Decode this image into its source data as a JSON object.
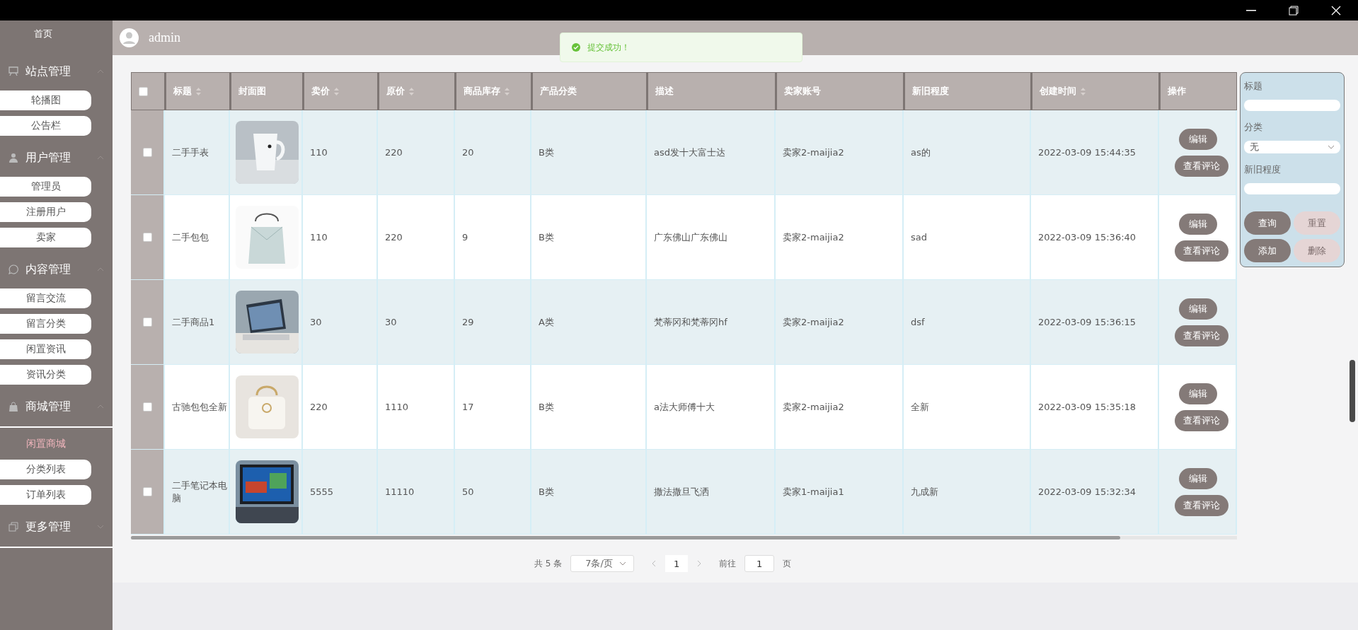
{
  "sidebar": {
    "home": "首页",
    "groups": [
      {
        "title": "站点管理",
        "expanded": true,
        "items": [
          {
            "label": "轮播图",
            "selected": false
          },
          {
            "label": "公告栏",
            "selected": false
          }
        ]
      },
      {
        "title": "用户管理",
        "expanded": true,
        "items": [
          {
            "label": "管理员",
            "selected": false
          },
          {
            "label": "注册用户",
            "selected": false
          },
          {
            "label": "卖家",
            "selected": false
          }
        ]
      },
      {
        "title": "内容管理",
        "expanded": true,
        "items": [
          {
            "label": "留言交流",
            "selected": false
          },
          {
            "label": "留言分类",
            "selected": false
          },
          {
            "label": "闲置资讯",
            "selected": false
          },
          {
            "label": "资讯分类",
            "selected": false
          }
        ]
      },
      {
        "title": "商城管理",
        "expanded": true,
        "items": [
          {
            "label": "闲置商城",
            "selected": true
          },
          {
            "label": "分类列表",
            "selected": false
          },
          {
            "label": "订单列表",
            "selected": false
          }
        ]
      },
      {
        "title": "更多管理",
        "expanded": false
      }
    ]
  },
  "header": {
    "username": "admin"
  },
  "toast": {
    "message": "提交成功！"
  },
  "table": {
    "all_checked": false,
    "columns": [
      {
        "label": "标题",
        "sortable": true
      },
      {
        "label": "封面图",
        "sortable": false
      },
      {
        "label": "卖价",
        "sortable": true
      },
      {
        "label": "原价",
        "sortable": true
      },
      {
        "label": "商品库存",
        "sortable": true
      },
      {
        "label": "产品分类",
        "sortable": false
      },
      {
        "label": "描述",
        "sortable": false
      },
      {
        "label": "卖家账号",
        "sortable": false
      },
      {
        "label": "新旧程度",
        "sortable": false
      },
      {
        "label": "创建时间",
        "sortable": true
      },
      {
        "label": "操作",
        "sortable": false
      }
    ],
    "rows": [
      {
        "checked": false,
        "title": "二手手表",
        "price": "110",
        "original_price": "220",
        "stock": "20",
        "category": "B类",
        "description": "asd发十大富士达",
        "seller": "卖家2-maijia2",
        "condition": "as的",
        "created": "2022-03-09 15:44:35",
        "actions": [
          "编辑",
          "查看评论"
        ]
      },
      {
        "checked": false,
        "title": "二手包包",
        "price": "110",
        "original_price": "220",
        "stock": "9",
        "category": "B类",
        "description": "广东佛山广东佛山",
        "seller": "卖家2-maijia2",
        "condition": "sad",
        "created": "2022-03-09 15:36:40",
        "actions": [
          "编辑",
          "查看评论"
        ]
      },
      {
        "checked": false,
        "title": "二手商品1",
        "price": "30",
        "original_price": "30",
        "stock": "29",
        "category": "A类",
        "description": "梵蒂冈和梵蒂冈hf",
        "seller": "卖家2-maijia2",
        "condition": "dsf",
        "created": "2022-03-09 15:36:15",
        "actions": [
          "编辑",
          "查看评论"
        ]
      },
      {
        "checked": false,
        "title": "古驰包包全新",
        "price": "220",
        "original_price": "1110",
        "stock": "17",
        "category": "B类",
        "description": "a法大师傅十大",
        "seller": "卖家2-maijia2",
        "condition": "全新",
        "created": "2022-03-09 15:35:18",
        "actions": [
          "编辑",
          "查看评论"
        ]
      },
      {
        "checked": false,
        "title": "二手笔记本电脑",
        "price": "5555",
        "original_price": "11110",
        "stock": "50",
        "category": "B类",
        "description": "撒法撒旦飞洒",
        "seller": "卖家1-maijia1",
        "condition": "九成新",
        "created": "2022-03-09 15:32:34",
        "actions": [
          "编辑",
          "查看评论"
        ]
      }
    ]
  },
  "filter": {
    "fields": [
      {
        "label": "标题",
        "kind": "input"
      },
      {
        "label": "分类",
        "kind": "select",
        "value": "无"
      },
      {
        "label": "新旧程度",
        "kind": "input"
      }
    ],
    "buttons": [
      {
        "label": "查询",
        "disabled": false
      },
      {
        "label": "重置",
        "disabled": true
      },
      {
        "label": "添加",
        "disabled": false
      },
      {
        "label": "删除",
        "disabled": true
      }
    ]
  },
  "pagination": {
    "total": "共 5 条",
    "page_size": "7条/页",
    "current": "1",
    "goto_label": "前往",
    "goto_value": "1",
    "page_suffix": "页"
  }
}
